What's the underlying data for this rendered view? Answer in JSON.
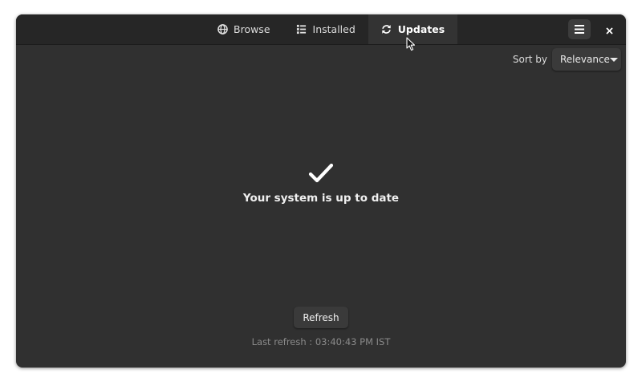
{
  "tabs": [
    {
      "label": "Browse",
      "icon": "globe-icon",
      "active": false
    },
    {
      "label": "Installed",
      "icon": "list-icon",
      "active": false
    },
    {
      "label": "Updates",
      "icon": "refresh-icon",
      "active": true
    }
  ],
  "header": {
    "menu_icon": "hamburger-menu-icon",
    "close_icon": "close-icon"
  },
  "sort": {
    "label": "Sort by",
    "selected": "Relevance"
  },
  "status": {
    "icon": "checkmark-icon",
    "message": "Your system is up to date"
  },
  "refresh": {
    "button_label": "Refresh",
    "last_refresh_text": "Last refresh : 03:40:43 PM IST"
  },
  "colors": {
    "window_bg": "#303030",
    "headerbar_bg": "#262626",
    "active_tab_bg": "#333333",
    "button_bg": "#3a3a3a",
    "text_primary": "#f0f0f0",
    "text_muted": "#8a8a8a"
  }
}
